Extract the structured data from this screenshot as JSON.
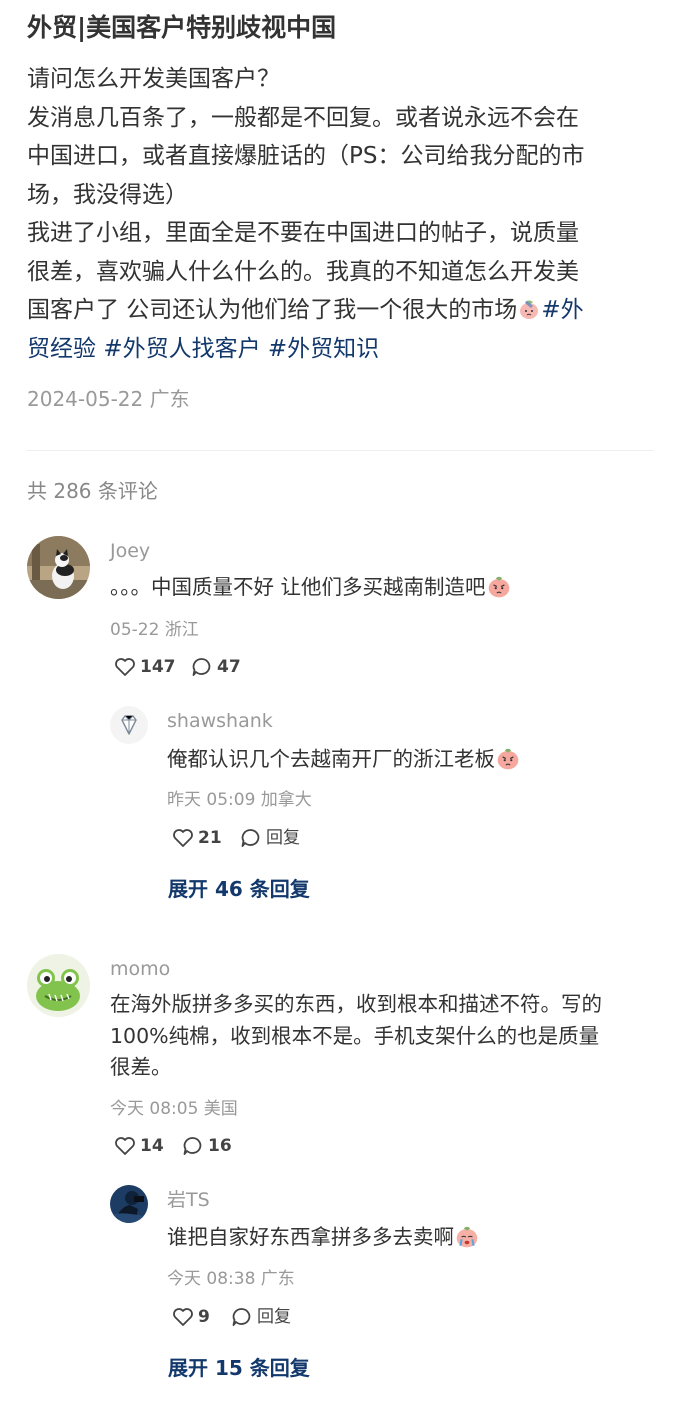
{
  "post": {
    "title": "外贸|美国客户特别歧视中国",
    "body_lines": [
      "请问怎么开发美国客户？",
      "发消息几百条了，一般都是不回复。或者说永远不会在",
      "中国进口，或者直接爆脏话的（PS：公司给我分配的市",
      "场，我没得选）",
      "我进了小组，里面全是不要在中国进口的帖子，说质量",
      "很差，喜欢骗人什么什么的。我真的不知道怎么开发美"
    ],
    "body_line7": "国客户了 公司还认为他们给了我一个很大的市场",
    "tag1_part1": "#外",
    "tag1_part2": "贸经验",
    "tag2": "#外贸人找客户",
    "tag3": "#外贸知识",
    "meta": "2024-05-22 广东",
    "body_emoji": "sweating-peach-emoji"
  },
  "comments_header": "共 286 条评论",
  "comments": [
    {
      "user": "Joey",
      "avatar": "cat-photo-avatar",
      "text": "。。。中国质量不好 让他们多买越南制造吧",
      "emoji": "pouting-peach-emoji",
      "meta": "05-22 浙江",
      "likes": "147",
      "replies_count": "47",
      "reply": {
        "user": "shawshank",
        "avatar": "diamond-avatar",
        "text": "俺都认识几个去越南开厂的浙江老板",
        "emoji": "pouting-peach-emoji",
        "meta": "昨天 05:09 加拿大",
        "likes": "21",
        "reply_label": "回复"
      },
      "expand": "展开 46 条回复"
    },
    {
      "user": "momo",
      "avatar": "frog-cartoon-avatar",
      "text_lines": [
        "在海外版拼多多买的东西，收到根本和描述不符。写的",
        "100%纯棉，收到根本不是。手机支架什么的也是质量",
        "很差。"
      ],
      "meta": "今天 08:05 美国",
      "likes": "14",
      "replies_count": "16",
      "reply": {
        "user": "岩TS",
        "avatar": "photographer-avatar",
        "text": "谁把自家好东西拿拼多多去卖啊",
        "emoji": "crying-peach-emoji",
        "meta": "今天 08:38 广东",
        "likes": "9",
        "reply_label": "回复"
      },
      "expand": "展开 15 条回复"
    }
  ],
  "colors": {
    "tag": "#13386c",
    "muted": "#999999",
    "text": "#333333"
  }
}
